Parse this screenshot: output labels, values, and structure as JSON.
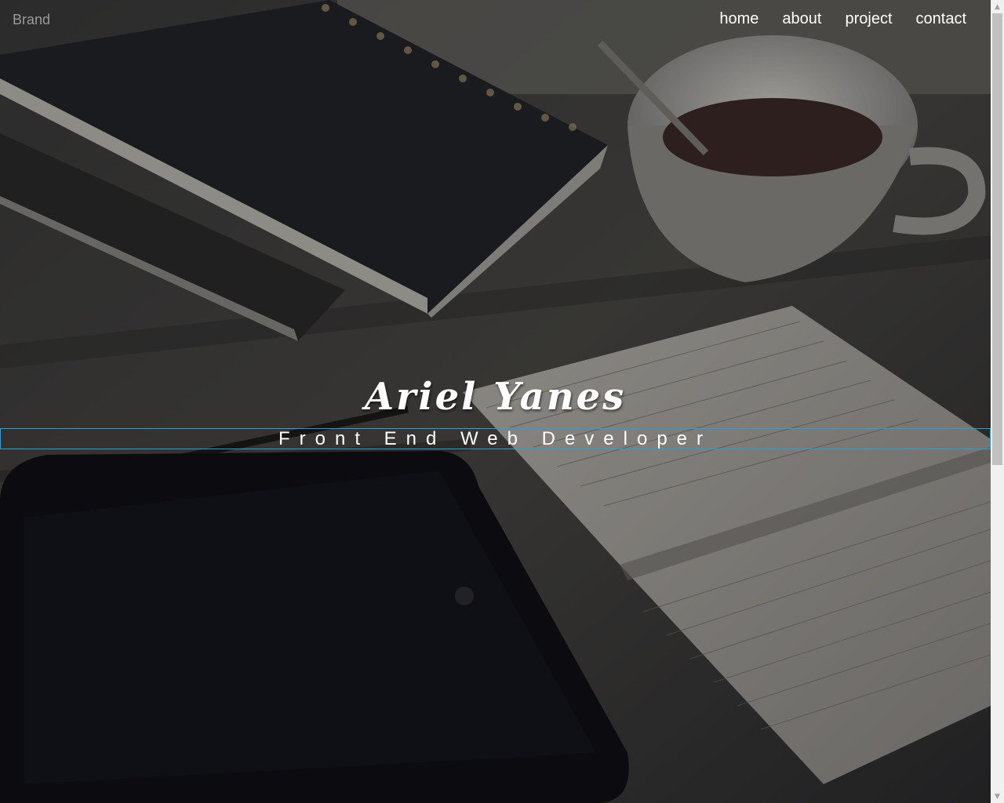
{
  "navbar": {
    "brand": "Brand",
    "links": [
      {
        "label": "home"
      },
      {
        "label": "about"
      },
      {
        "label": "project"
      },
      {
        "label": "contact"
      }
    ]
  },
  "hero": {
    "name": "Ariel Yanes",
    "title": "Front End Web Developer"
  },
  "colors": {
    "title_outline": "#2b9fd6",
    "nav_text": "#ffffff",
    "brand_text": "#9a9a9a"
  }
}
